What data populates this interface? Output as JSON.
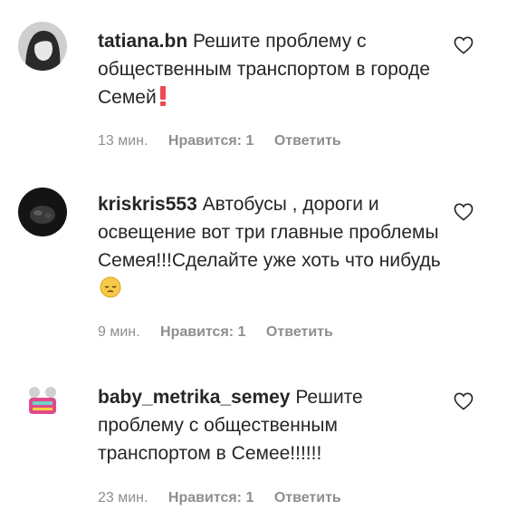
{
  "comments": [
    {
      "username": "tatiana.bn",
      "text": "Решите проблему с общественным транспортом в городе Семей",
      "emoji_icon": "red-exclamation-icon",
      "time": "13 мин.",
      "likes": "Нравится: 1",
      "reply": "Ответить"
    },
    {
      "username": "kriskris553",
      "text": "Автобусы , дороги и освещение вот три главные проблемы Семея!!!Сделайте уже хоть что нибудь",
      "emoji_icon": "pensive-face-icon",
      "time": "9 мин.",
      "likes": "Нравится: 1",
      "reply": "Ответить"
    },
    {
      "username": "baby_metrika_semey",
      "text": "Решите проблему с общественным транспортом в Семее!!!!!!",
      "time": "23 мин.",
      "likes": "Нравится: 1",
      "reply": "Ответить"
    }
  ],
  "colors": {
    "text": "#262626",
    "meta": "#8e8e8e",
    "exclamation": "#ed4956",
    "emoji": "#f7c948"
  }
}
